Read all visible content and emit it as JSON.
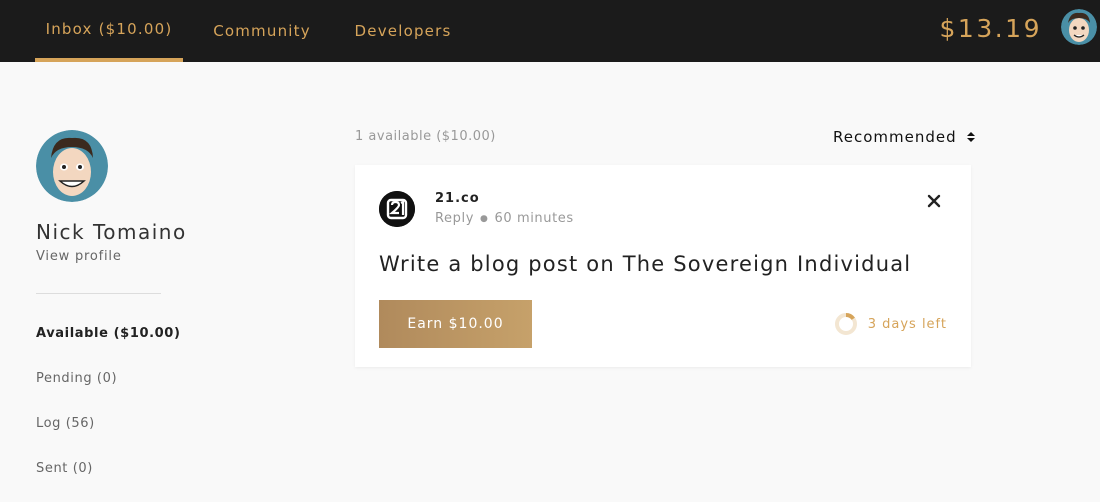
{
  "nav": {
    "tabs": [
      {
        "label": "Inbox ($10.00)",
        "active": true
      },
      {
        "label": "Community",
        "active": false
      },
      {
        "label": "Developers",
        "active": false
      }
    ],
    "balance": "$13.19",
    "avatar_icon": "user-avatar-icon"
  },
  "profile": {
    "name": "Nick Tomaino",
    "view_profile": "View profile"
  },
  "sidebar": {
    "items": [
      {
        "label": "Available ($10.00)",
        "active": true
      },
      {
        "label": "Pending (0)",
        "active": false
      },
      {
        "label": "Log (56)",
        "active": false
      },
      {
        "label": "Sent (0)",
        "active": false
      }
    ]
  },
  "list": {
    "count_text": "1 available ($10.00)",
    "sort_label": "Recommended"
  },
  "task": {
    "sender": "21.co",
    "reply_label": "Reply",
    "time": "60 minutes",
    "title": "Write a blog post on The Sovereign Individual",
    "earn_label": "Earn $10.00",
    "time_left": "3 days left",
    "time_left_progress": 0.15
  },
  "colors": {
    "accent": "#d6a45a",
    "topbar": "#1b1b1b",
    "button": "#b08a5c"
  }
}
